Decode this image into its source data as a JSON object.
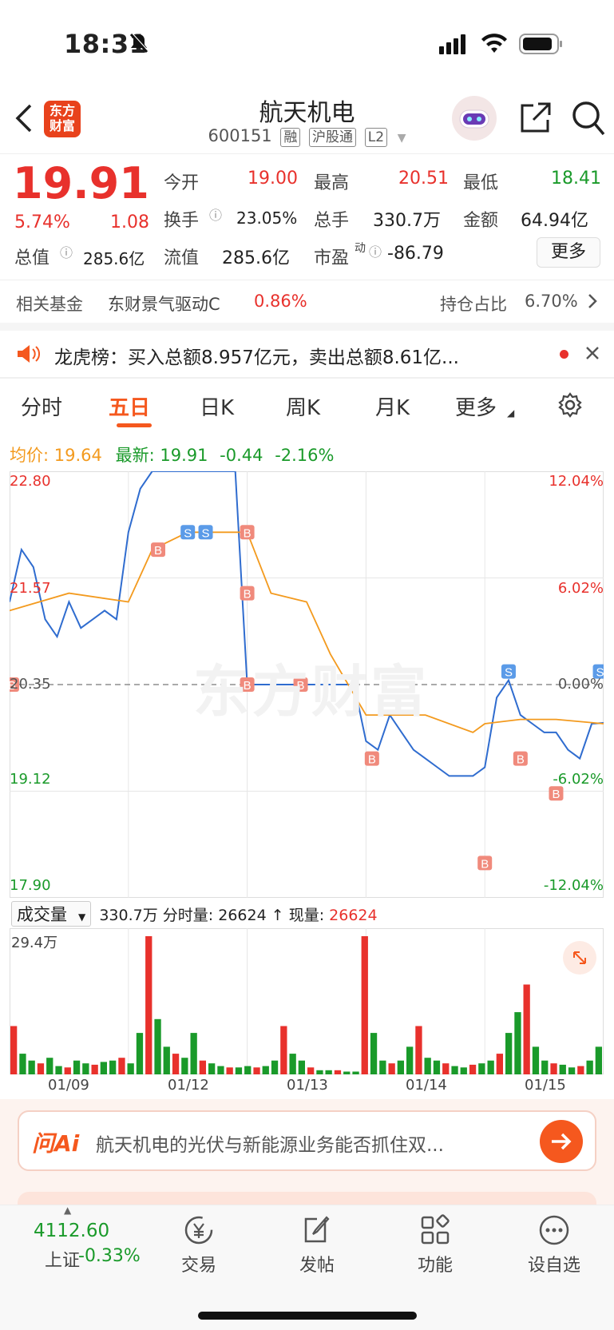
{
  "status_bar": {
    "time": "18:31"
  },
  "header": {
    "logo_text": "东方财富",
    "title": "航天机电",
    "code": "600151",
    "tags": [
      "融",
      "沪股通",
      "L2"
    ]
  },
  "quote": {
    "price": "19.91",
    "change_pct": "5.74%",
    "change": "1.08",
    "open_label": "今开",
    "open": "19.00",
    "high_label": "最高",
    "high": "20.51",
    "low_label": "最低",
    "low": "18.41",
    "turnover_label": "换手",
    "turnover": "23.05%",
    "volume_label": "总手",
    "volume": "330.7万",
    "amount_label": "金额",
    "amount": "64.94亿",
    "mktcap_label": "总值",
    "mktcap": "285.6亿",
    "float_label": "流值",
    "float": "285.6亿",
    "pe_label": "市盈",
    "pe_sup": "动",
    "pe": "-86.79",
    "more_label": "更多"
  },
  "fund": {
    "label": "相关基金",
    "name": "东财景气驱动C",
    "pct": "0.86%",
    "holding_label": "持仓占比",
    "holding": "6.70%"
  },
  "notice": {
    "text": "龙虎榜：买入总额8.957亿元，卖出总额8.61亿..."
  },
  "tabs": [
    "分时",
    "五日",
    "日K",
    "周K",
    "月K",
    "更多"
  ],
  "active_tab": "五日",
  "chart_header": {
    "avg_label": "均价:",
    "avg": "19.64",
    "latest_label": "最新:",
    "latest": "19.91",
    "diff": "-0.44",
    "diff_pct": "-2.16%"
  },
  "chart_data": {
    "type": "line",
    "y_ticks_left": [
      "22.80",
      "21.57",
      "20.35",
      "19.12",
      "17.90"
    ],
    "y_ticks_right": [
      "12.04%",
      "6.02%",
      "0.00%",
      "-6.02%",
      "-12.04%"
    ],
    "x_ticks": [
      "01/09",
      "01/12",
      "01/13",
      "01/14",
      "01/15"
    ],
    "ylim": [
      17.9,
      22.8
    ],
    "prev_close": 20.35,
    "series": [
      {
        "x": [
          0,
          0.1,
          0.2,
          0.3,
          0.4,
          0.5,
          0.6,
          0.7,
          0.8,
          0.9,
          1.0,
          1.1,
          1.2,
          1.3,
          1.4,
          1.5,
          1.6,
          1.7,
          1.8,
          1.9,
          2.0,
          2.1,
          2.2,
          2.3,
          2.4,
          2.5,
          2.6,
          2.7,
          2.8,
          2.9,
          3.0,
          3.1,
          3.2,
          3.3,
          3.4,
          3.5,
          3.6,
          3.7,
          3.8,
          3.9,
          4.0,
          4.1,
          4.2,
          4.3,
          4.4,
          4.5,
          4.6,
          4.7,
          4.8,
          4.9,
          5.0
        ],
        "y": [
          21.3,
          21.9,
          21.7,
          21.1,
          20.9,
          21.3,
          21.0,
          21.1,
          21.2,
          21.1,
          22.1,
          22.6,
          22.8,
          22.8,
          22.8,
          22.8,
          22.8,
          22.8,
          22.8,
          22.8,
          20.35,
          20.35,
          20.35,
          20.35,
          20.35,
          20.35,
          20.35,
          20.35,
          20.35,
          20.35,
          19.7,
          19.6,
          20.0,
          19.8,
          19.6,
          19.5,
          19.4,
          19.3,
          19.3,
          19.3,
          19.4,
          20.2,
          20.4,
          20.0,
          19.9,
          19.8,
          19.8,
          19.6,
          19.5,
          19.9,
          19.91
        ]
      },
      {
        "x": [
          0,
          0.5,
          1.0,
          1.2,
          1.5,
          2.0,
          2.2,
          2.5,
          2.7,
          3.0,
          3.5,
          3.9,
          4.0,
          4.3,
          4.6,
          5.0
        ],
        "y": [
          21.2,
          21.4,
          21.3,
          21.9,
          22.1,
          22.1,
          21.4,
          21.3,
          20.7,
          20.0,
          20.0,
          19.8,
          19.9,
          19.95,
          19.95,
          19.9
        ]
      }
    ],
    "series_colors": [
      "#2f6ccf",
      "#f39a1e"
    ],
    "markers": {
      "buy": "B",
      "sell": "S"
    }
  },
  "volume": {
    "label": "成交量",
    "total": "330.7万",
    "period_label": "分时量:",
    "period": "26624",
    "arrow": "↑",
    "current_label": "现量:",
    "current": "26624",
    "max_label": "29.4万",
    "values": [
      0.35,
      0.15,
      0.1,
      0.08,
      0.12,
      0.06,
      0.05,
      0.1,
      0.08,
      0.07,
      0.09,
      0.1,
      0.12,
      0.08,
      0.3,
      1.0,
      0.4,
      0.2,
      0.15,
      0.12,
      0.3,
      0.1,
      0.08,
      0.06,
      0.05,
      0.05,
      0.06,
      0.05,
      0.06,
      0.1,
      0.35,
      0.15,
      0.1,
      0.05,
      0.03,
      0.03,
      0.03,
      0.02,
      0.02,
      1.0,
      0.3,
      0.1,
      0.08,
      0.1,
      0.2,
      0.35,
      0.12,
      0.1,
      0.08,
      0.06,
      0.05,
      0.07,
      0.08,
      0.1,
      0.15,
      0.3,
      0.45,
      0.65,
      0.2,
      0.1,
      0.08,
      0.07,
      0.05,
      0.06,
      0.1,
      0.2
    ]
  },
  "ai": {
    "label": "问Ai",
    "text": "航天机电的光伏与新能源业务能否抓住双..."
  },
  "bottom_nav": {
    "index_value": "4112.60",
    "index_name": "上证",
    "index_change": "-0.33%",
    "items": [
      "交易",
      "发帖",
      "功能",
      "设自选"
    ]
  },
  "colors": {
    "up": "#e8312c",
    "down": "#1a9a2a",
    "accent": "#f5581e"
  }
}
